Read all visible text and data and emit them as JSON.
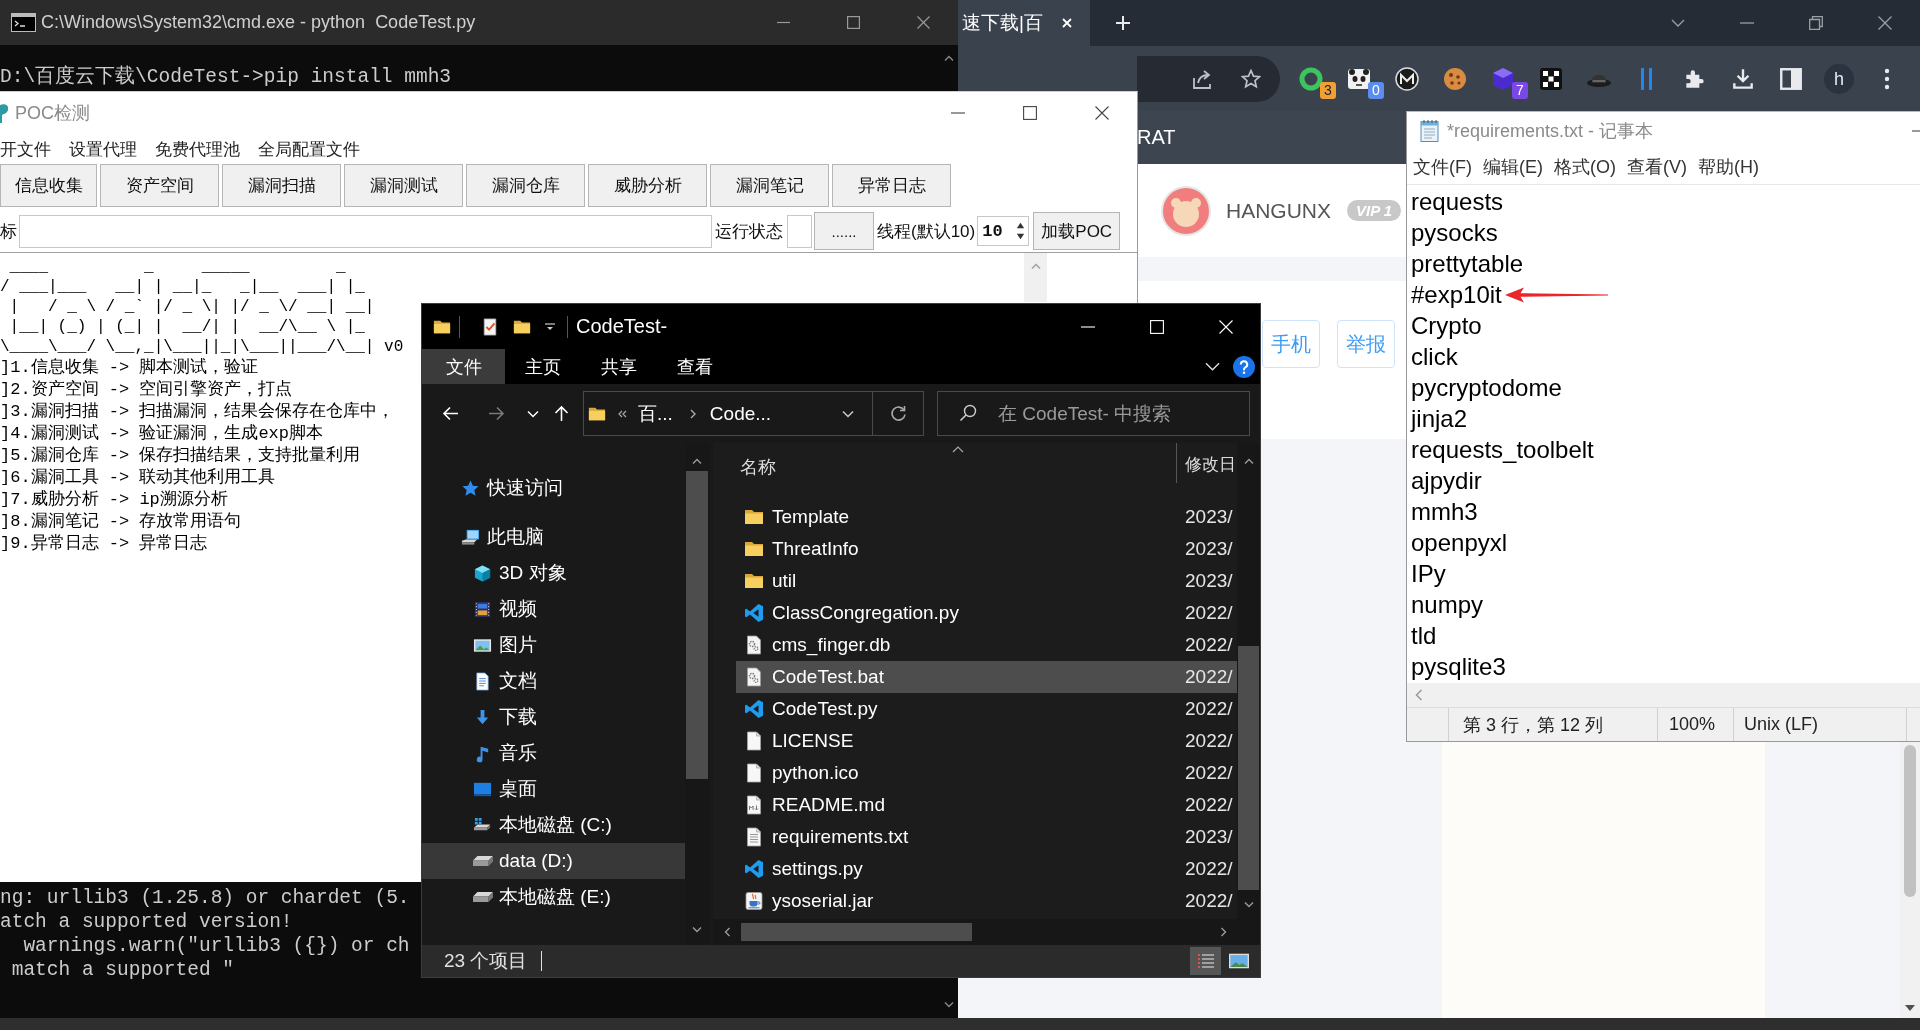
{
  "browser": {
    "tab": {
      "title": "速下载|百"
    },
    "extensions": [
      {
        "kind": "ring",
        "badge": "3"
      },
      {
        "kind": "panda",
        "badge": "0"
      },
      {
        "kind": "m-circle"
      },
      {
        "kind": "cookie"
      },
      {
        "kind": "cube",
        "badge": "7"
      },
      {
        "kind": "dice"
      },
      {
        "kind": "hat"
      },
      {
        "kind": "bars"
      }
    ],
    "profile": {
      "initial": "h"
    },
    "page": {
      "header": "RAT",
      "user": {
        "name": "HANGUNX",
        "badge": "VIP 1"
      },
      "buttons": [
        "手机",
        "举报"
      ]
    }
  },
  "cmd": {
    "title": "C:\\Windows\\System32\\cmd.exe - python  CodeTest.py",
    "top_lines": [
      "D:\\百度云下载\\CodeTest->pip install mmh3"
    ],
    "bottom_lines": [
      "ng: urllib3 (1.25.8) or chardet (5.",
      "atch a supported version!",
      "  warnings.warn(\"urllib3 ({}) or ch",
      " match a supported \""
    ]
  },
  "poc": {
    "title": "POC检测",
    "menu": [
      "开文件",
      "设置代理",
      "免费代理池",
      "全局配置文件"
    ],
    "buttons": [
      "信息收集",
      "资产空间",
      "漏洞扫描",
      "漏洞测试",
      "漏洞仓库",
      "威胁分析",
      "漏洞笔记",
      "异常日志"
    ],
    "target_label": "标",
    "status_label": "运行状态",
    "browse_button": "......",
    "threads": {
      "label": "线程(默认10)",
      "value": "10"
    },
    "load_button": "加载POC",
    "banner": [
      " ____          _     _____         _",
      "/ ___|___   __| | __|_   _|__  ___| |_",
      " |   / _ \\ / _` |/ _ \\| |/ _ \\/ __| __|",
      " |__| (_) | (_| |  __/| |  __/\\__ \\ |_",
      "\\____\\___/ \\__,_|\\___||_|\\___||___/\\__| v0"
    ],
    "features": [
      "]1.信息收集 -> 脚本测试，验证",
      "]2.资产空间 -> 空间引擎资产，打点",
      "]3.漏洞扫描 -> 扫描漏洞，结果会保存在仓库中，",
      "]4.漏洞测试 -> 验证漏洞，生成exp脚本",
      "]5.漏洞仓库 -> 保存扫描结果，支持批量利用",
      "]6.漏洞工具 -> 联动其他利用工具",
      "]7.威胁分析 -> ip溯源分析",
      "]8.漏洞笔记 -> 存放常用语句",
      "]9.异常日志 -> 异常日志"
    ]
  },
  "explorer": {
    "title": "CodeTest-",
    "ribbon": [
      {
        "label": "文件",
        "selected": true
      },
      {
        "label": "主页",
        "selected": false
      },
      {
        "label": "共享",
        "selected": false
      },
      {
        "label": "查看",
        "selected": false
      }
    ],
    "path": [
      "百...",
      "Code..."
    ],
    "search": {
      "placeholder": "在 CodeTest- 中搜索"
    },
    "nav": [
      {
        "label": "快速访问",
        "kind": "star",
        "selected": false
      },
      {
        "label": "此电脑",
        "kind": "computer",
        "selected": false,
        "children": [
          {
            "label": "3D 对象",
            "kind": "cube",
            "selected": false
          },
          {
            "label": "视频",
            "kind": "film",
            "selected": false
          },
          {
            "label": "图片",
            "kind": "picture",
            "selected": false
          },
          {
            "label": "文档",
            "kind": "document",
            "selected": false
          },
          {
            "label": "下载",
            "kind": "download",
            "selected": false
          },
          {
            "label": "音乐",
            "kind": "music",
            "selected": false
          },
          {
            "label": "桌面",
            "kind": "desktop",
            "selected": false
          },
          {
            "label": "本地磁盘 (C:)",
            "kind": "system-drive",
            "selected": false
          },
          {
            "label": "data (D:)",
            "kind": "drive",
            "selected": true
          },
          {
            "label": "本地磁盘 (E:)",
            "kind": "drive",
            "selected": false
          }
        ]
      }
    ],
    "columns": [
      "名称",
      "修改日"
    ],
    "files": [
      {
        "name": "Template",
        "kind": "folder",
        "date": "2023/",
        "selected": false
      },
      {
        "name": "ThreatInfo",
        "kind": "folder",
        "date": "2023/",
        "selected": false
      },
      {
        "name": "util",
        "kind": "folder",
        "date": "2023/",
        "selected": false
      },
      {
        "name": "ClassCongregation.py",
        "kind": "code",
        "date": "2022/",
        "selected": false
      },
      {
        "name": "cms_finger.db",
        "kind": "gear-file",
        "date": "2022/",
        "selected": false
      },
      {
        "name": "CodeTest.bat",
        "kind": "gear-file",
        "date": "2022/",
        "selected": true
      },
      {
        "name": "CodeTest.py",
        "kind": "code",
        "date": "2022/",
        "selected": false
      },
      {
        "name": "LICENSE",
        "kind": "file",
        "date": "2022/",
        "selected": false
      },
      {
        "name": "python.ico",
        "kind": "file",
        "date": "2022/",
        "selected": false
      },
      {
        "name": "README.md",
        "kind": "markdown",
        "date": "2022/",
        "selected": false
      },
      {
        "name": "requirements.txt",
        "kind": "text",
        "date": "2023/",
        "selected": false
      },
      {
        "name": "settings.py",
        "kind": "code",
        "date": "2022/",
        "selected": false
      },
      {
        "name": "ysoserial.jar",
        "kind": "cup",
        "date": "2022/",
        "selected": false
      }
    ],
    "status": "23 个项目",
    "views": [
      {
        "kind": "details",
        "selected": true
      },
      {
        "kind": "large-icons",
        "selected": false
      }
    ]
  },
  "notepad": {
    "title": "*requirements.txt - 记事本",
    "menu": [
      "文件(F)",
      "编辑(E)",
      "格式(O)",
      "查看(V)",
      "帮助(H)"
    ],
    "lines": [
      {
        "text": "requests",
        "marked": false
      },
      {
        "text": "pysocks",
        "marked": false
      },
      {
        "text": "prettytable",
        "marked": false
      },
      {
        "text": "#exp10it",
        "marked": true
      },
      {
        "text": "Crypto",
        "marked": false
      },
      {
        "text": "click",
        "marked": false
      },
      {
        "text": "pycryptodome",
        "marked": false
      },
      {
        "text": "jinja2",
        "marked": false
      },
      {
        "text": "requests_toolbelt",
        "marked": false
      },
      {
        "text": "ajpydir",
        "marked": false
      },
      {
        "text": "mmh3",
        "marked": false
      },
      {
        "text": "openpyxl",
        "marked": false
      },
      {
        "text": "IPy",
        "marked": false
      },
      {
        "text": "numpy",
        "marked": false
      },
      {
        "text": "tld",
        "marked": false
      },
      {
        "text": "pysqlite3",
        "marked": false
      }
    ],
    "status": [
      "第 3 行，第 12 列",
      "100%",
      "Unix (LF)"
    ]
  }
}
